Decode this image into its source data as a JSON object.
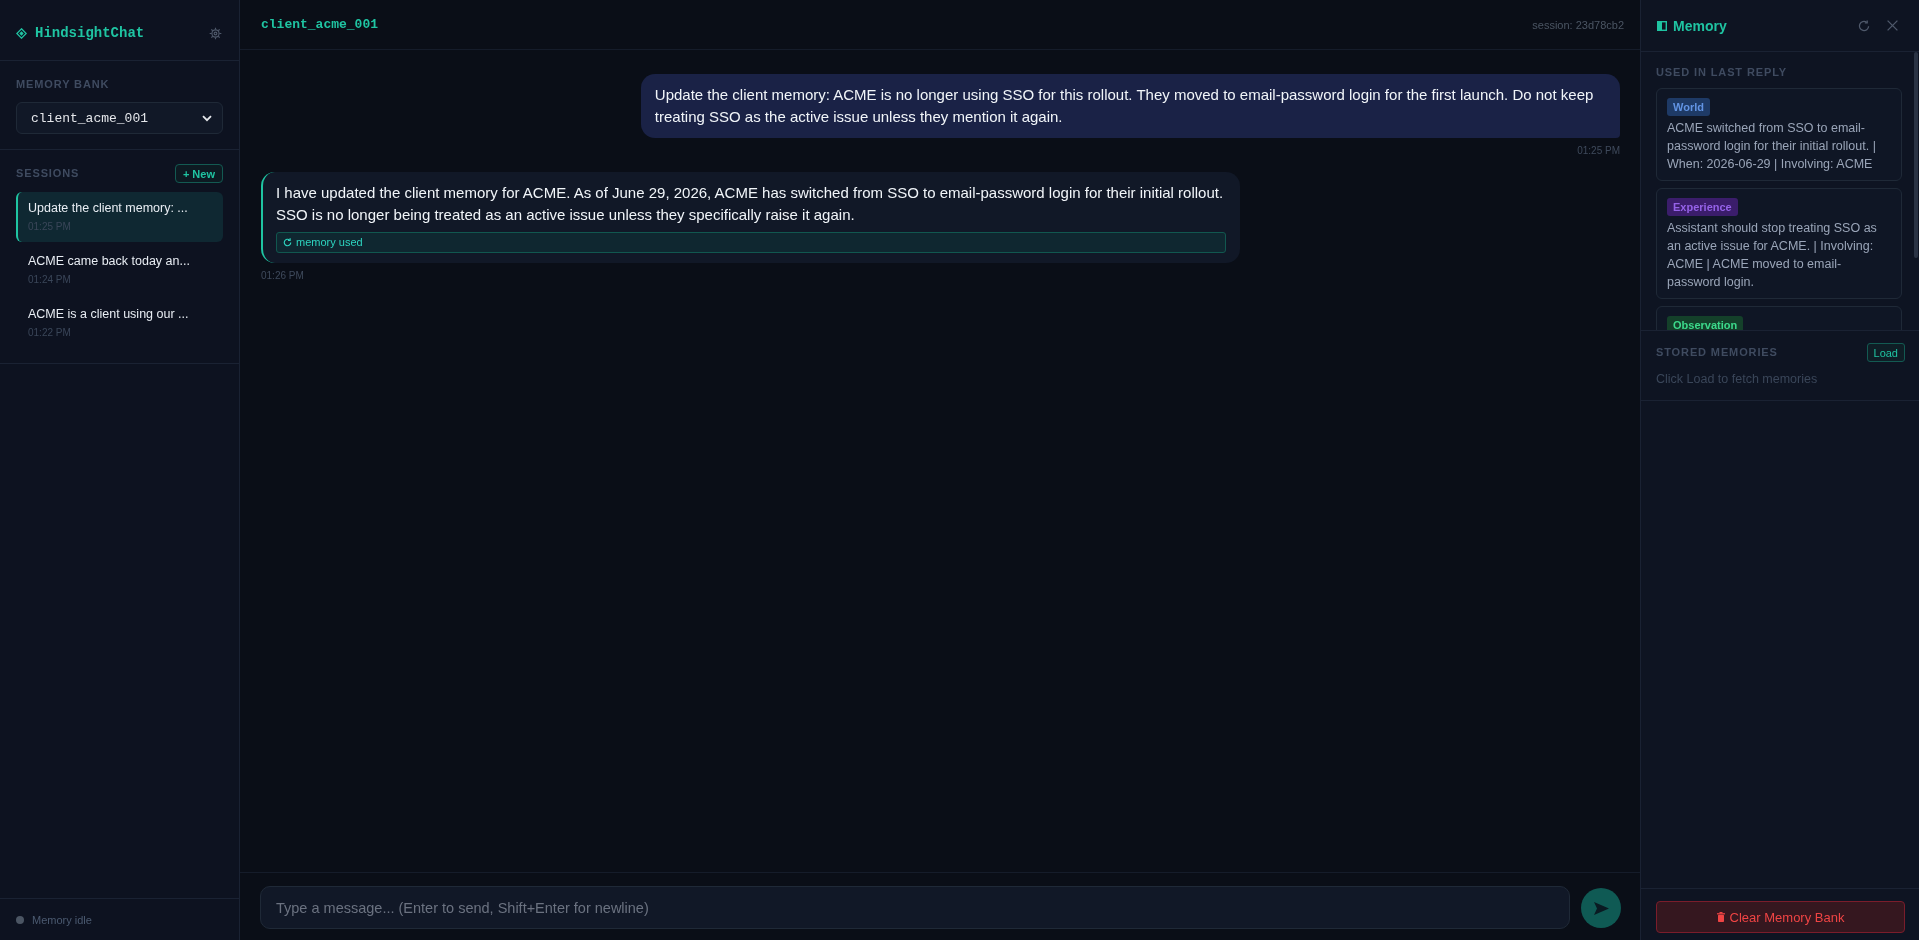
{
  "sidebar": {
    "brand": "HindsightChat",
    "memory_bank": {
      "label": "MEMORY BANK",
      "value": "client_acme_001"
    },
    "sessions": {
      "label": "SESSIONS",
      "new_button": "+ New",
      "items": [
        {
          "title": "Update the client memory: ...",
          "time": "01:25 PM",
          "selected": true
        },
        {
          "title": "ACME came back today an...",
          "time": "01:24 PM",
          "selected": false
        },
        {
          "title": "ACME is a client using our ...",
          "time": "01:22 PM",
          "selected": false
        }
      ]
    },
    "status": "Memory idle"
  },
  "chat": {
    "title": "client_acme_001",
    "session": "session: 23d78cb2",
    "messages": [
      {
        "kind": "user",
        "text": "Update the client memory: ACME is no longer using SSO for this rollout. They moved to email-password login for the first launch. Do not keep treating SSO as the active issue unless they mention it again.",
        "time": "01:25 PM"
      },
      {
        "kind": "assistant",
        "text": "I have updated the client memory for ACME. As of June 29, 2026, ACME has switched from SSO to email-password login for their initial rollout. SSO is no longer being treated as an active issue unless they specifically raise it again.",
        "badge": "memory used",
        "time": "01:26 PM"
      }
    ],
    "input": {
      "placeholder": "Type a message... (Enter to send, Shift+Enter for newline)"
    }
  },
  "memory_panel": {
    "title": "Memory",
    "used": {
      "label": "USED IN LAST REPLY",
      "items": [
        {
          "type": "World",
          "color": "#1e3a66",
          "text": "ACME switched from SSO to email-password login for their initial rollout. | When: 2026-06-29 | Involving: ACME"
        },
        {
          "type": "Experience",
          "color": "#3b1d6b",
          "text": "Assistant should stop treating SSO as an active issue for ACME. | Involving: ACME | ACME moved to email-password login."
        },
        {
          "type": "Observation",
          "color": "#14402a"
        }
      ]
    },
    "stored": {
      "label": "STORED MEMORIES",
      "load_button": "Load",
      "hint": "Click Load to fetch memories"
    },
    "clear_button": "Clear Memory Bank"
  }
}
